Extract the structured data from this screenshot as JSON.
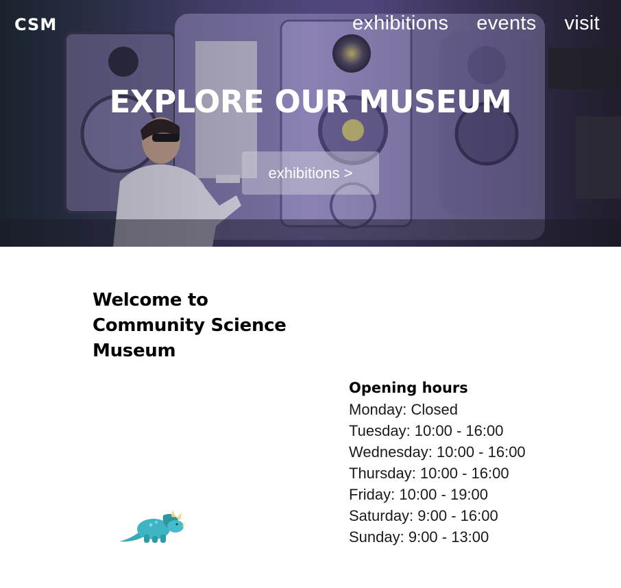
{
  "header": {
    "logo": "CSM",
    "nav": [
      {
        "label": "exhibitions"
      },
      {
        "label": "events"
      },
      {
        "label": "visit"
      }
    ]
  },
  "hero": {
    "title": "EXPLORE OUR MUSEUM",
    "button_label": "exhibitions >"
  },
  "welcome": {
    "line1": "Welcome to",
    "line2": "Community Science",
    "line3": "Museum"
  },
  "hours": {
    "title": "Opening hours",
    "lines": [
      "Monday: Closed",
      "Tuesday: 10:00 - 16:00",
      "Wednesday: 10:00 - 16:00",
      "Thursday: 10:00 - 16:00",
      "Friday: 10:00 - 19:00",
      "Saturday: 9:00 - 16:00",
      "Sunday: 9:00 - 13:00"
    ]
  },
  "illustration": {
    "icon": "dinosaur-icon",
    "color": "#3aa9b8"
  },
  "colors": {
    "hero_tint": "#4a3f7a",
    "text": "#000000",
    "button_bg": "#d2d2dc"
  }
}
